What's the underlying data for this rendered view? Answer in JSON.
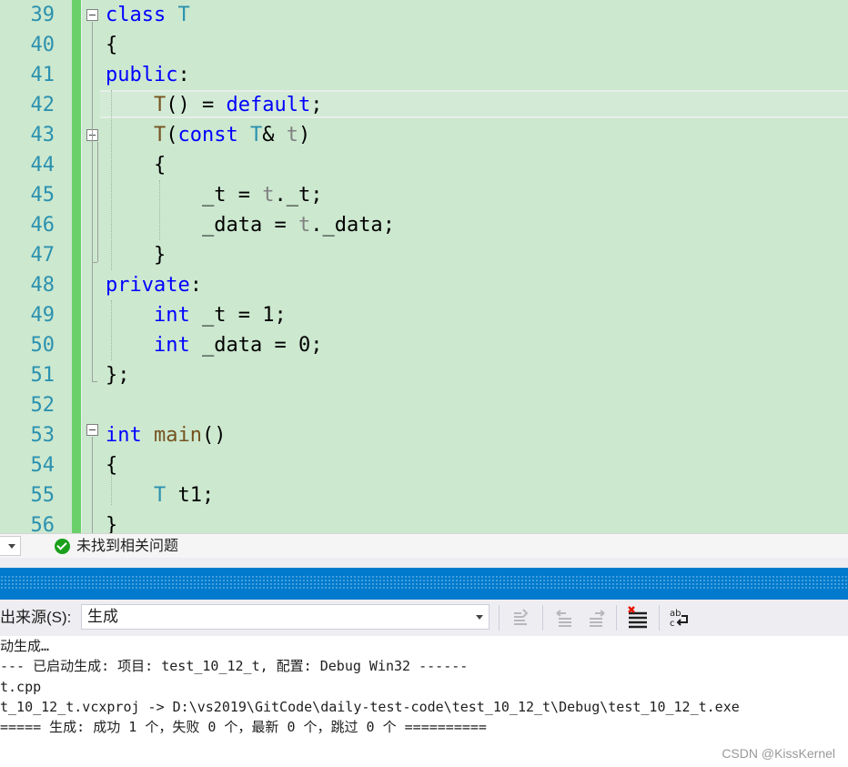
{
  "editor": {
    "line_numbers": [
      "39",
      "40",
      "41",
      "42",
      "43",
      "44",
      "45",
      "46",
      "47",
      "48",
      "49",
      "50",
      "51",
      "52",
      "53",
      "54",
      "55",
      "56"
    ],
    "lines": [
      [
        {
          "t": "class ",
          "c": "kw"
        },
        {
          "t": "T",
          "c": "ty"
        }
      ],
      [
        {
          "t": "{",
          "c": "pu"
        }
      ],
      [
        {
          "t": "public",
          "c": "kw"
        },
        {
          "t": ":",
          "c": "pu"
        }
      ],
      [
        {
          "t": "    ",
          "c": "pu"
        },
        {
          "t": "T",
          "c": "fn"
        },
        {
          "t": "() = ",
          "c": "pu"
        },
        {
          "t": "default",
          "c": "kw"
        },
        {
          "t": ";",
          "c": "pu"
        }
      ],
      [
        {
          "t": "    ",
          "c": "pu"
        },
        {
          "t": "T",
          "c": "fn"
        },
        {
          "t": "(",
          "c": "pu"
        },
        {
          "t": "const ",
          "c": "kw"
        },
        {
          "t": "T",
          "c": "ty"
        },
        {
          "t": "& ",
          "c": "pu"
        },
        {
          "t": "t",
          "c": "pm"
        },
        {
          "t": ")",
          "c": "pu"
        }
      ],
      [
        {
          "t": "    {",
          "c": "pu"
        }
      ],
      [
        {
          "t": "        ",
          "c": "pu"
        },
        {
          "t": "_t",
          "c": "mb"
        },
        {
          "t": " = ",
          "c": "pu"
        },
        {
          "t": "t",
          "c": "pm"
        },
        {
          "t": ".",
          "c": "pu"
        },
        {
          "t": "_t",
          "c": "mb"
        },
        {
          "t": ";",
          "c": "pu"
        }
      ],
      [
        {
          "t": "        ",
          "c": "pu"
        },
        {
          "t": "_data",
          "c": "mb"
        },
        {
          "t": " = ",
          "c": "pu"
        },
        {
          "t": "t",
          "c": "pm"
        },
        {
          "t": ".",
          "c": "pu"
        },
        {
          "t": "_data",
          "c": "mb"
        },
        {
          "t": ";",
          "c": "pu"
        }
      ],
      [
        {
          "t": "    }",
          "c": "pu"
        }
      ],
      [
        {
          "t": "private",
          "c": "kw"
        },
        {
          "t": ":",
          "c": "pu"
        }
      ],
      [
        {
          "t": "    ",
          "c": "pu"
        },
        {
          "t": "int ",
          "c": "kw"
        },
        {
          "t": "_t",
          "c": "mb"
        },
        {
          "t": " = ",
          "c": "pu"
        },
        {
          "t": "1",
          "c": "nm"
        },
        {
          "t": ";",
          "c": "pu"
        }
      ],
      [
        {
          "t": "    ",
          "c": "pu"
        },
        {
          "t": "int ",
          "c": "kw"
        },
        {
          "t": "_data",
          "c": "mb"
        },
        {
          "t": " = ",
          "c": "pu"
        },
        {
          "t": "0",
          "c": "nm"
        },
        {
          "t": ";",
          "c": "pu"
        }
      ],
      [
        {
          "t": "};",
          "c": "pu"
        }
      ],
      [],
      [
        {
          "t": "int ",
          "c": "kw"
        },
        {
          "t": "main",
          "c": "fn"
        },
        {
          "t": "()",
          "c": "pu"
        }
      ],
      [
        {
          "t": "{",
          "c": "pu"
        }
      ],
      [
        {
          "t": "    ",
          "c": "pu"
        },
        {
          "t": "T ",
          "c": "ty"
        },
        {
          "t": "t1",
          "c": "pu"
        },
        {
          "t": ";",
          "c": "pu"
        }
      ],
      [
        {
          "t": "}",
          "c": "pu"
        }
      ]
    ]
  },
  "status": {
    "issues_text": "未找到相关问题",
    "issues_icon": "check-circle-icon"
  },
  "output": {
    "source_label": "出来源(S):",
    "source_value": "生成",
    "toolbar_icons": [
      "go-to-location-icon",
      "previous-message-icon",
      "next-message-icon",
      "clear-all-icon",
      "toggle-word-wrap-icon"
    ],
    "lines": [
      "动生成…",
      "--- 已启动生成: 项目: test_10_12_t, 配置: Debug Win32 ------",
      "t.cpp",
      "t_10_12_t.vcxproj -> D:\\vs2019\\GitCode\\daily-test-code\\test_10_12_t\\Debug\\test_10_12_t.exe",
      "===== 生成: 成功 1 个，失败 0 个，最新 0 个，跳过 0 个 =========="
    ]
  },
  "watermark": "CSDN @KissKernel",
  "colors": {
    "editor_bg": "#cce8cf",
    "keyword": "#0000ff",
    "type": "#2b91af",
    "function": "#74531f",
    "parameter": "#808080",
    "change_bar": "#6ad16a",
    "title_bar": "#007acc"
  }
}
